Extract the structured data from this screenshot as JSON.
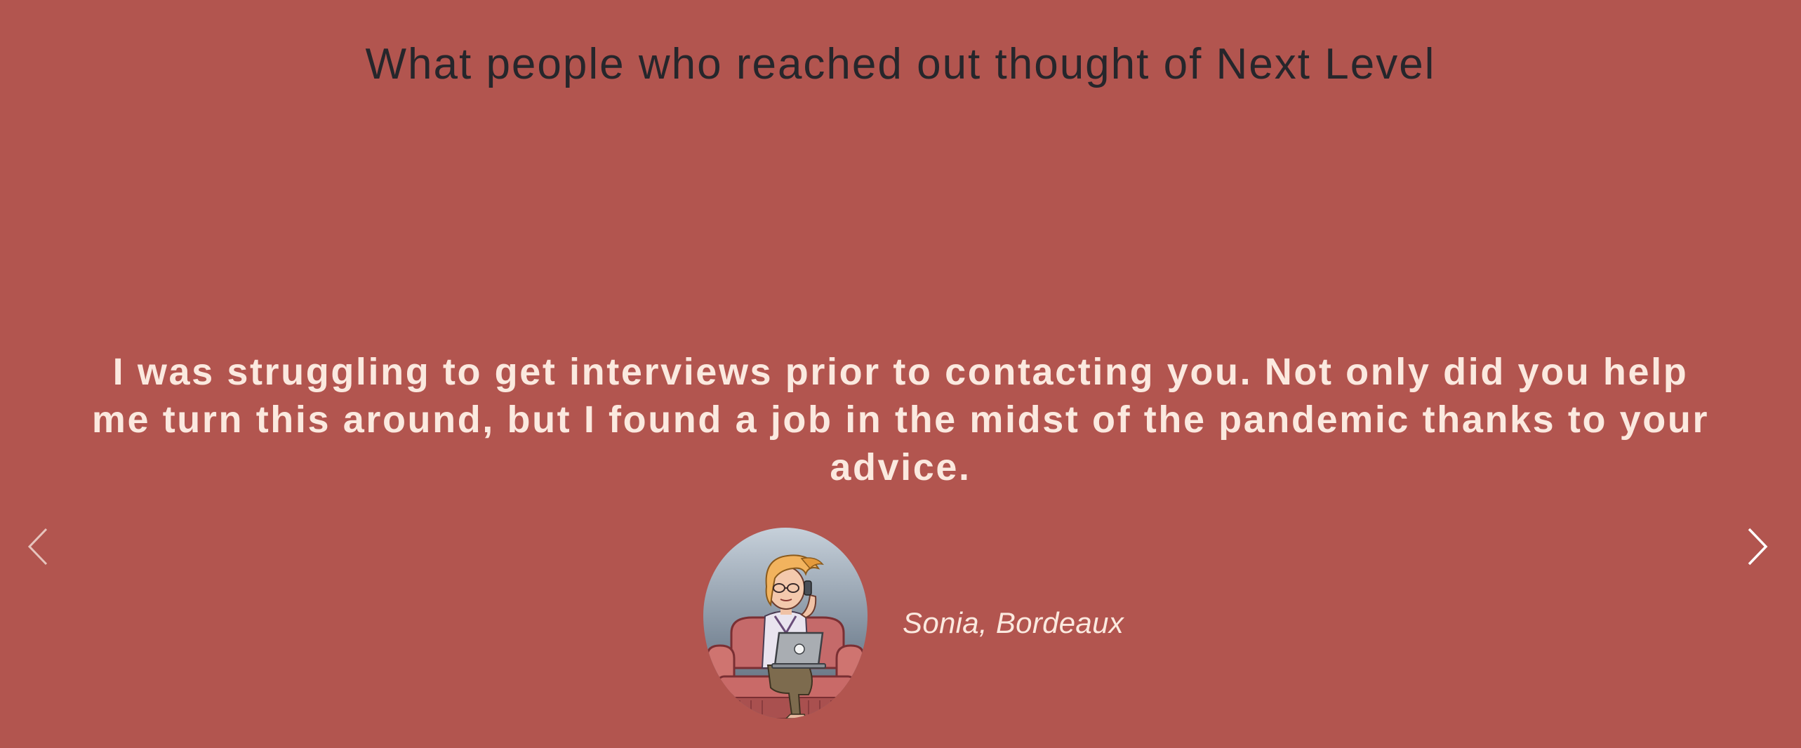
{
  "testimonials": {
    "heading": "What people who reached out thought of Next Level",
    "quote": "I was struggling to get interviews prior to contacting you. Not only did you help me turn this around, but I found a job in the midst of the pandemic thanks to your advice.",
    "author": "Sonia, Bordeaux",
    "avatar_icon": "woman-on-sofa-with-laptop-illustration",
    "prev_icon": "chevron-left-icon",
    "next_icon": "chevron-right-icon"
  },
  "colors": {
    "background": "#b2554f",
    "heading": "#26262b",
    "quote_text": "#fbe9df"
  }
}
